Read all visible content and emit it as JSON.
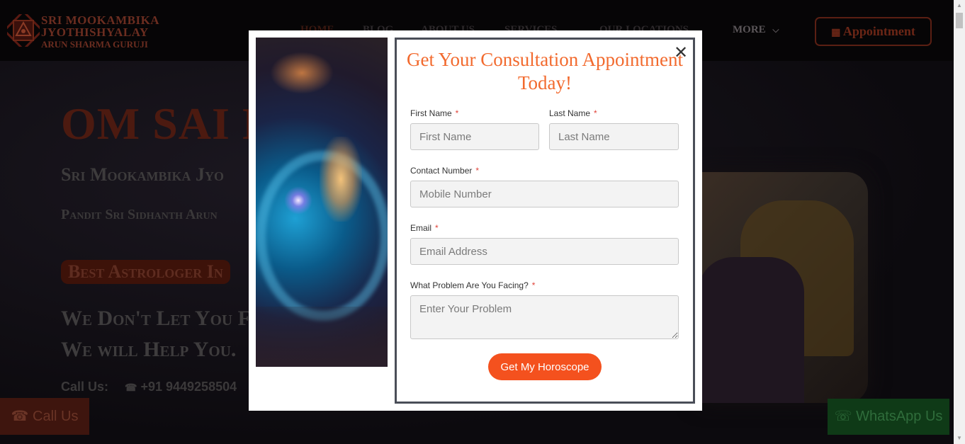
{
  "header": {
    "brand_line1": "SRI MOOKAMBIKA",
    "brand_line2": "JYOTHISHYALAY",
    "brand_line3": "ARUN SHARMA GURUJI",
    "nav": [
      "HOME",
      "BLOG",
      "ABOUT US",
      "SERVICES",
      "OUR LOCATIONS",
      "MORE"
    ],
    "appointment_label": "Appointment"
  },
  "hero": {
    "title": "OM SAI N",
    "subtitle": "Sri Mookambika Jyo",
    "pandit": "Pandit Sri Sidhanth Arun",
    "badge": "Best Astrologer In",
    "dont_line1": "We Don't Let You F",
    "dont_line2": "We will Help You.",
    "call_label": "Call Us:",
    "phone": "+91 9449258504"
  },
  "floating": {
    "call_label": "Call Us",
    "whatsapp_label": "WhatsApp Us"
  },
  "modal": {
    "title": "Get Your Consultation Appointment Today!",
    "close_glyph": "✕",
    "fields": {
      "first_name": {
        "label": "First Name",
        "placeholder": "First Name"
      },
      "last_name": {
        "label": "Last Name",
        "placeholder": "Last Name"
      },
      "contact": {
        "label": "Contact Number",
        "placeholder": "Mobile Number"
      },
      "email": {
        "label": "Email",
        "placeholder": "Email Address"
      },
      "problem": {
        "label": "What Problem Are You Facing?",
        "placeholder": "Enter Your Problem"
      }
    },
    "required_mark": "*",
    "submit_label": "Get My Horoscope"
  },
  "colors": {
    "accent": "#f4511e",
    "title": "#f26a2e",
    "overlay": "#0d0b0f"
  }
}
